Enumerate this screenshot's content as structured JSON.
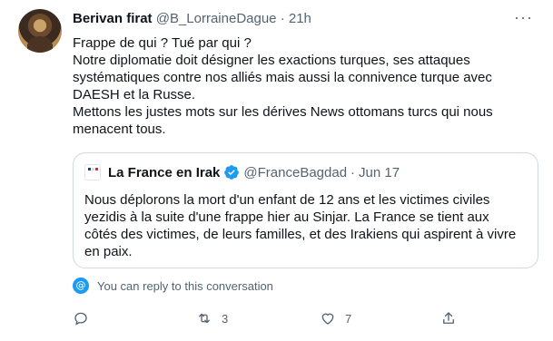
{
  "tweet": {
    "author_name": "Berivan firat",
    "author_handle": "@B_LorraineDague",
    "separator": "·",
    "time": "21h",
    "more_label": "···",
    "lines": [
      "Frappe de qui ?  Tué par qui ?",
      "Notre diplomatie doit désigner les exactions turques, ses attaques",
      "systématiques contre nos alliés mais aussi  la connivence turque avec",
      "DAESH et  la Russe.",
      "Mettons les justes  mots  sur les dérives News ottomans turcs qui nous",
      "menacent tous."
    ]
  },
  "quoted": {
    "author_name": "La France en Irak",
    "author_handle": "@FranceBagdad",
    "separator": "·",
    "date": "Jun 17",
    "verified_color": "#1d9bf0",
    "lines": [
      "Nous déplorons la mort d'un enfant de 12 ans et les victimes civiles",
      "yezidis à la suite d'une frappe hier au Sinjar. La France se tient aux",
      "côtés des victimes, de leurs familles, et des Irakiens qui aspirent à vivre",
      "en paix."
    ]
  },
  "reply_note": "You can reply to this conversation",
  "actions": {
    "reply_count": "",
    "retweet_count": "3",
    "like_count": "7"
  },
  "colors": {
    "text": "#0f1419",
    "muted": "#536471",
    "accent": "#1d9bf0",
    "border": "#cfd9de"
  },
  "icons": [
    "reply-icon",
    "retweet-icon",
    "like-icon",
    "share-icon",
    "more-icon",
    "verified-badge-icon",
    "reply-permission-icon"
  ]
}
